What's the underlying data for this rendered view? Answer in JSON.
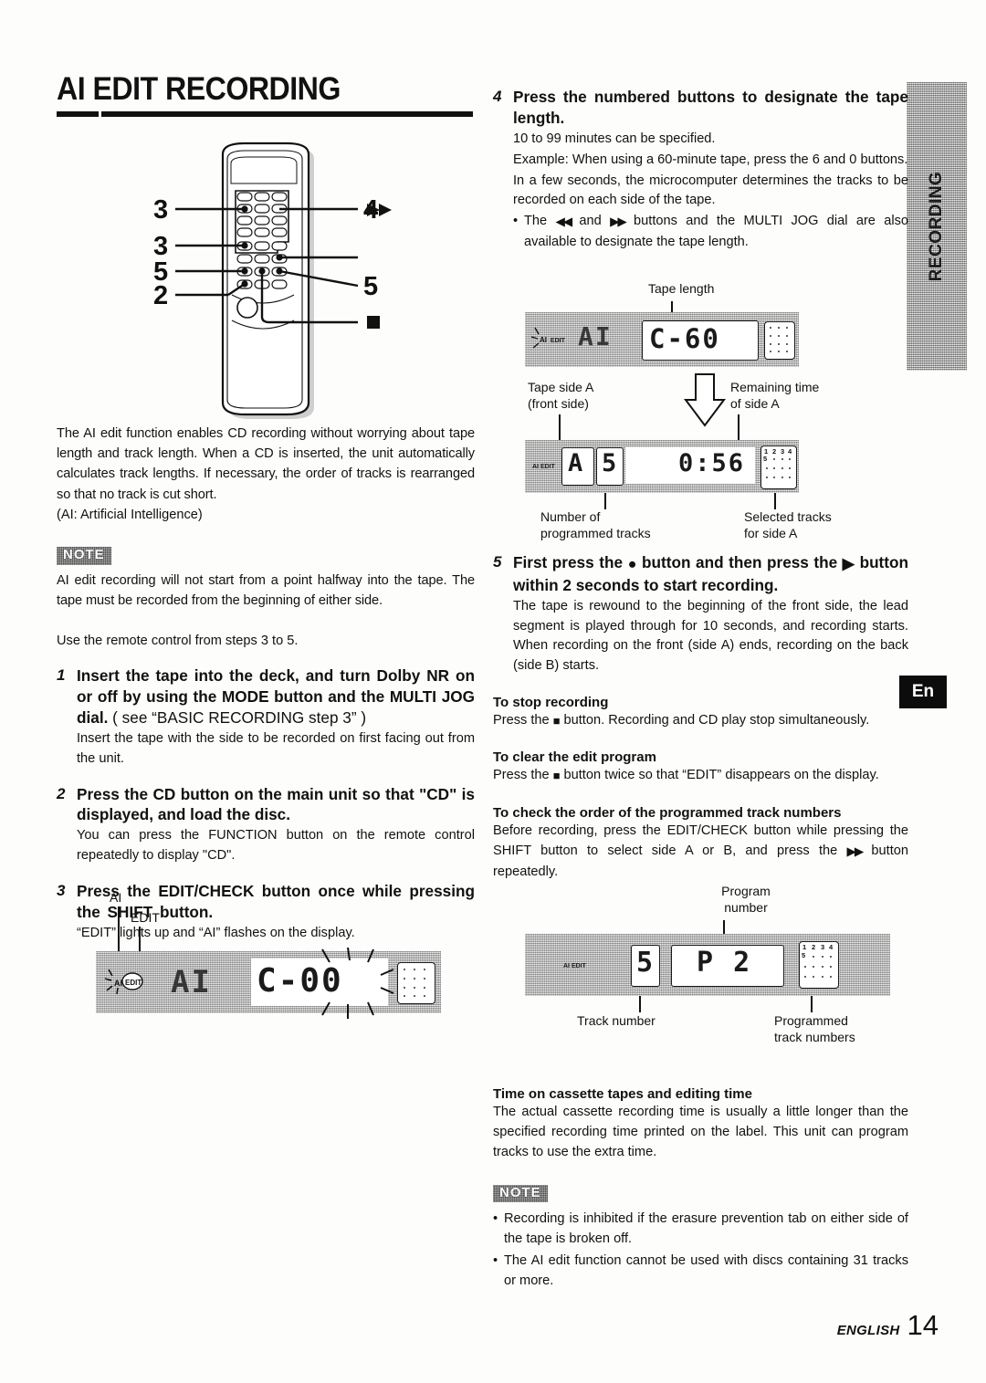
{
  "page": {
    "title": "AI EDIT RECORDING",
    "footer_label": "ENGLISH",
    "footer_page": "14",
    "side_tab_recording": "RECORDING",
    "side_tab_lang": "En"
  },
  "left": {
    "intro": "The AI edit function enables CD recording without worrying about tape length and track length.  When a CD is inserted, the unit automatically calculates track lengths.  If necessary, the order of tracks is rearranged so that no track is cut short.",
    "intro_line2": "(AI: Artificial Intelligence)",
    "note_badge": "NOTE",
    "note_text": "AI edit recording will not start from a point halfway into the tape. The tape must be recorded from the beginning of either side.",
    "use_remote": "Use the remote control from steps 3 to 5.",
    "steps": [
      {
        "num": "1",
        "head_bold": "Insert the tape into the deck, and turn Dolby NR on or off by using the MODE button and the MULTI JOG dial.",
        "head_regular": "( see “BASIC RECORDING step 3” )",
        "sub": "Insert the tape with the side to be recorded on first facing out from the unit."
      },
      {
        "num": "2",
        "head_bold": "Press the CD button on the main unit so that \"CD\" is displayed, and load the disc.",
        "head_regular": "",
        "sub": "You can press the FUNCTION button on the remote control repeatedly to display \"CD\"."
      },
      {
        "num": "3",
        "head_bold": "Press the EDIT/CHECK button once while pressing the SHIFT button.",
        "head_regular": "",
        "sub": "“EDIT” lights up and “AI” flashes on the display."
      }
    ],
    "remote_callouts": {
      "left": [
        "3",
        "3",
        "5",
        "2"
      ],
      "right_top": "4",
      "right_ff": "ff-icon",
      "right_five": "5",
      "right_stop": "stop-icon"
    },
    "lcd_step3": {
      "label_ai": "AI",
      "label_edit": "EDIT",
      "indicator": "AI EDIT",
      "segment_left": "AI",
      "segment_right": "C-00"
    }
  },
  "right": {
    "step4": {
      "num": "4",
      "head": "Press the numbered buttons to designate the tape length.",
      "lines": [
        "10 to 99 minutes can be specified.",
        "Example:  When using a 60-minute tape, press the 6 and 0 buttons.",
        "In a few seconds, the microcomputer determines the tracks to be recorded on each side of the tape."
      ],
      "bullet_pre": "The ",
      "bullet_mid": " and ",
      "bullet_post": " buttons and the MULTI JOG dial are also available to designate the tape length."
    },
    "diagram1": {
      "caption_top": "Tape length",
      "caption_side_a_l1": "Tape side A",
      "caption_side_a_l2": "(front side)",
      "caption_remaining_l1": "Remaining time",
      "caption_remaining_l2": "of side A",
      "caption_progtracks_l1": "Number of",
      "caption_progtracks_l2": "programmed tracks",
      "caption_selected_l1": "Selected tracks",
      "caption_selected_l2": "for side A",
      "lcd_top": {
        "indicator": "AI EDIT",
        "segment_left": "AI",
        "segment_right": "C-60"
      },
      "lcd_bottom": {
        "indicator": "AI EDIT",
        "side": "A",
        "tracks": "5",
        "time": "0:56",
        "matrix_labels": [
          "1",
          "2",
          "3",
          "4",
          "5"
        ]
      }
    },
    "step5": {
      "num": "5",
      "head_pre": "First press the ",
      "head_mid": " button and then press the ",
      "head_post": " button within 2 seconds to start recording.",
      "sub": "The tape is rewound to the beginning of the front side, the lead segment is played through for 10 seconds, and recording starts.  When recording on the front (side A) ends, recording on the back (side B) starts."
    },
    "stop_recording": {
      "head": "To stop recording",
      "pre": "Press the ",
      "post": " button. Recording and CD play stop simultaneously."
    },
    "clear_program": {
      "head": "To clear the edit program",
      "pre": "Press the ",
      "post": " button twice so that “EDIT” disappears on the display."
    },
    "check_order": {
      "head": "To check the order of the programmed track numbers",
      "pre": "Before recording, press the EDIT/CHECK button while pressing the SHIFT button to select side A or B, and press the ",
      "post": " button repeatedly."
    },
    "diagram2": {
      "caption_program_l1": "Program",
      "caption_program_l2": "number",
      "caption_track": "Track number",
      "caption_progtracks_l1": "Programmed",
      "caption_progtracks_l2": "track numbers",
      "lcd": {
        "indicator": "AI EDIT",
        "track": "5",
        "program": "P 2",
        "matrix_labels": [
          "1",
          "2",
          "3",
          "4",
          "5"
        ]
      }
    },
    "cassette_time": {
      "head": "Time on cassette tapes and editing time",
      "body": "The actual cassette recording time is usually a little longer than the specified recording time printed on the label.  This unit can program tracks to use the extra time."
    },
    "final_note": {
      "badge": "NOTE",
      "bullets": [
        "Recording is inhibited if the erasure prevention tab on either side of the tape is broken off.",
        "The AI edit function cannot be used with discs containing 31 tracks or more."
      ]
    }
  }
}
